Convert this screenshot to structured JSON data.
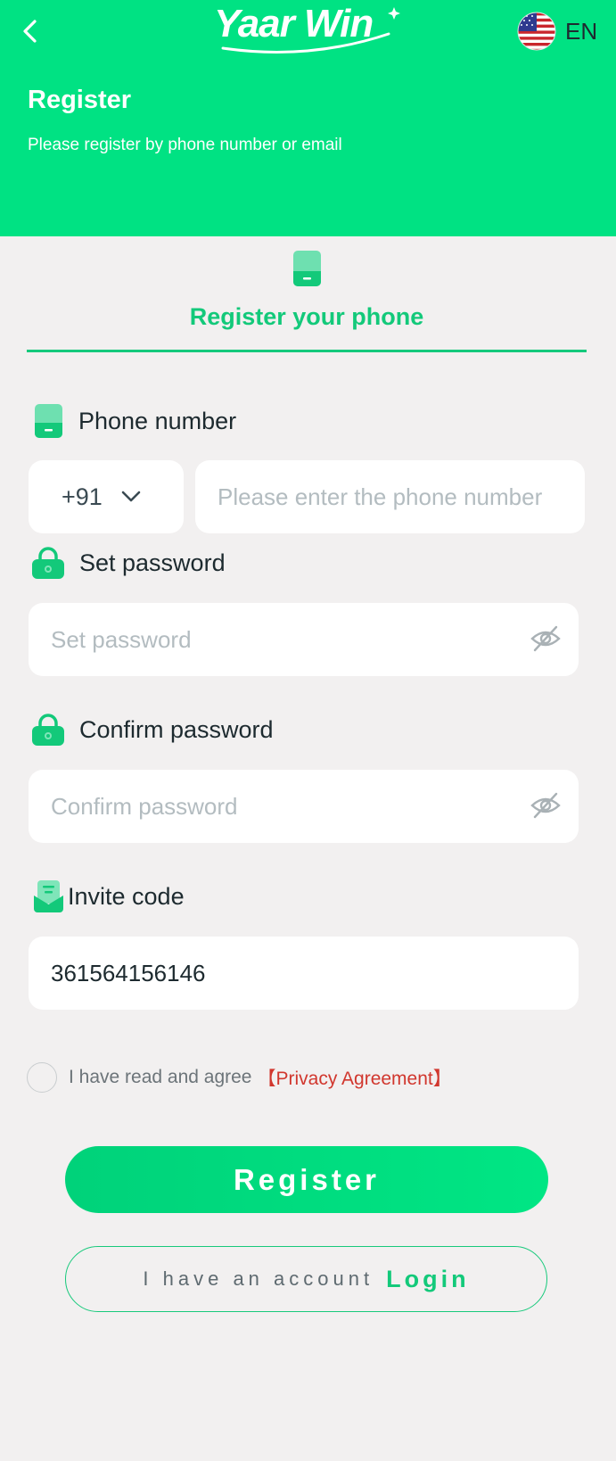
{
  "header": {
    "logo_text": "Yaar Win",
    "language": "EN",
    "title": "Register",
    "subtitle": "Please register by phone number or email"
  },
  "tab": {
    "label": "Register your phone"
  },
  "form": {
    "phone": {
      "label": "Phone number",
      "country_code": "+91",
      "placeholder": "Please enter the phone number",
      "value": ""
    },
    "password": {
      "label": "Set password",
      "placeholder": "Set password",
      "value": ""
    },
    "confirm_password": {
      "label": "Confirm password",
      "placeholder": "Confirm password",
      "value": ""
    },
    "invite": {
      "label": "Invite code",
      "placeholder": "",
      "value": "361564156146"
    }
  },
  "agreement": {
    "text": "I have read and agree",
    "link": "【Privacy Agreement】",
    "checked": false
  },
  "buttons": {
    "register": "Register",
    "have_account": "I have an account",
    "login": "Login"
  },
  "colors": {
    "brand_green": "#00e283",
    "accent_green": "#13c97a",
    "link_red": "#d1372e",
    "background": "#f2f0f0"
  }
}
